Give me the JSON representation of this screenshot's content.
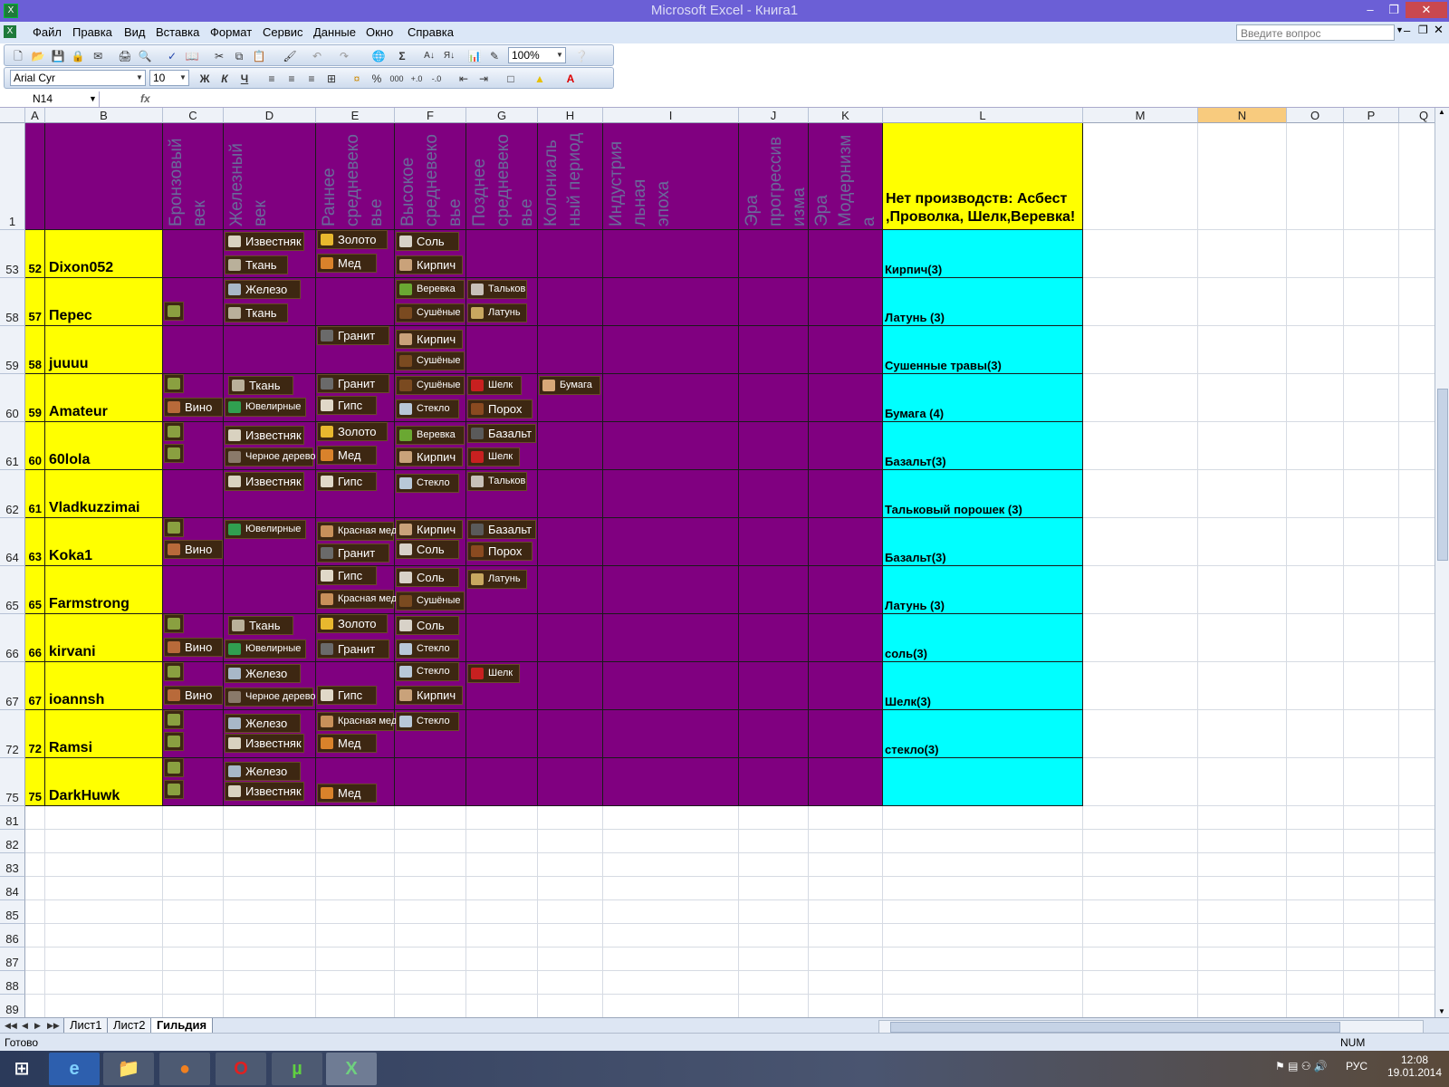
{
  "window": {
    "title": "Microsoft Excel - Книга1"
  },
  "menu": [
    "Файл",
    "Правка",
    "Вид",
    "Вставка",
    "Формат",
    "Сервис",
    "Данные",
    "Окно",
    "Справка"
  ],
  "ask_placeholder": "Введите вопрос",
  "toolbar": {
    "zoom": "100%",
    "font": "Arial Cyr",
    "size": "10",
    "bold": "Ж",
    "italic": "К",
    "underline": "Ч",
    "sigma": "Σ",
    "percent": "%",
    "thousands": "000"
  },
  "namebox": "N14",
  "fx": "fx",
  "columns": [
    "A",
    "B",
    "C",
    "D",
    "E",
    "F",
    "G",
    "H",
    "I",
    "J",
    "K",
    "L",
    "M",
    "N",
    "O",
    "P",
    "Q"
  ],
  "header_row": {
    "row_no": "1",
    "eras": [
      "Бронзовый век",
      "Железный век",
      "Раннее средневековье",
      "Высокое средневековье",
      "Позднее средневековье",
      "Колониальный период",
      "Индустриальная эпоха",
      "Эра прогрессивизма",
      "Эра Модернизма"
    ],
    "era_lines": [
      [
        "Бронзовый",
        "век"
      ],
      [
        "Железный",
        "век"
      ],
      [
        "Раннее",
        "средневеко",
        "вье"
      ],
      [
        "Высокое",
        "средневеко",
        "вье"
      ],
      [
        "Позднее",
        "средневеко",
        "вье"
      ],
      [
        "Колониаль",
        "ный период"
      ],
      [
        "Индустрия",
        "льная",
        "эпоха"
      ],
      [
        "Эра",
        "прогрессив",
        "изма"
      ],
      [
        "Эра",
        "Модернизм",
        "а"
      ]
    ],
    "note": "Нет производств: Асбест ,Проволка, Шелк,Веревка!"
  },
  "rows": [
    {
      "row": "53",
      "num": "52",
      "name": "Dixon052",
      "note": "Кирпич(3)"
    },
    {
      "row": "58",
      "num": "57",
      "name": "Перес",
      "note": "Латунь (3)"
    },
    {
      "row": "59",
      "num": "58",
      "name": "juuuu",
      "note": "Сушенные травы(3)"
    },
    {
      "row": "60",
      "num": "59",
      "name": "Amateur",
      "note": "Бумага (4)"
    },
    {
      "row": "61",
      "num": "60",
      "name": "60lola",
      "note": "Базальт(3)"
    },
    {
      "row": "62",
      "num": "61",
      "name": "Vladkuzzimai",
      "note": "Тальковый порошек (3)"
    },
    {
      "row": "64",
      "num": "63",
      "name": "Koka1",
      "note": "Базальт(3)"
    },
    {
      "row": "65",
      "num": "65",
      "name": "Farmstrong",
      "note": "Латунь (3)"
    },
    {
      "row": "66",
      "num": "66",
      "name": "kirvani",
      "note": "соль(3)"
    },
    {
      "row": "67",
      "num": "67",
      "name": "ioannsh",
      "note": "Шелк(3)"
    },
    {
      "row": "72",
      "num": "72",
      "name": "Ramsi",
      "note": "стекло(3)"
    },
    {
      "row": "75",
      "num": "75",
      "name": "DarkHuwk",
      "note": ""
    }
  ],
  "empty_rows": [
    "81",
    "82",
    "83",
    "84",
    "85",
    "86",
    "87",
    "88",
    "89"
  ],
  "badges": {
    "izvestnyak": "Известняк",
    "tkan": "Ткань",
    "zoloto": "Золото",
    "med": "Мед",
    "sol": "Соль",
    "kirpich": "Кирпич",
    "zhelezo": "Железо",
    "verevka": "Веревка",
    "sushenye": "Сушёные",
    "talkov": "Тальков",
    "latun": "Латунь",
    "granit": "Гранит",
    "yuvelirnye": "Ювелирные",
    "steklo": "Стекло",
    "shelk": "Шелк",
    "porokh": "Порох",
    "bumaga": "Бумага",
    "vino": "Вино",
    "cherno_derevo": "Черное дерево",
    "gips": "Гипс",
    "bazalt": "Базальт",
    "krasnaya_med": "Красная медь"
  },
  "sheets": [
    "Лист1",
    "Лист2",
    "Гильдия"
  ],
  "active_sheet": "Гильдия",
  "status": {
    "ready": "Готово",
    "num": "NUM"
  },
  "taskbar": {
    "lang": "РУС",
    "time": "12:08",
    "date": "19.01.2014"
  },
  "colors": {
    "purple": "#800080",
    "yellow": "#FFFF00",
    "cyan": "#00FFFF",
    "selected_col": "#F8CB7E"
  }
}
